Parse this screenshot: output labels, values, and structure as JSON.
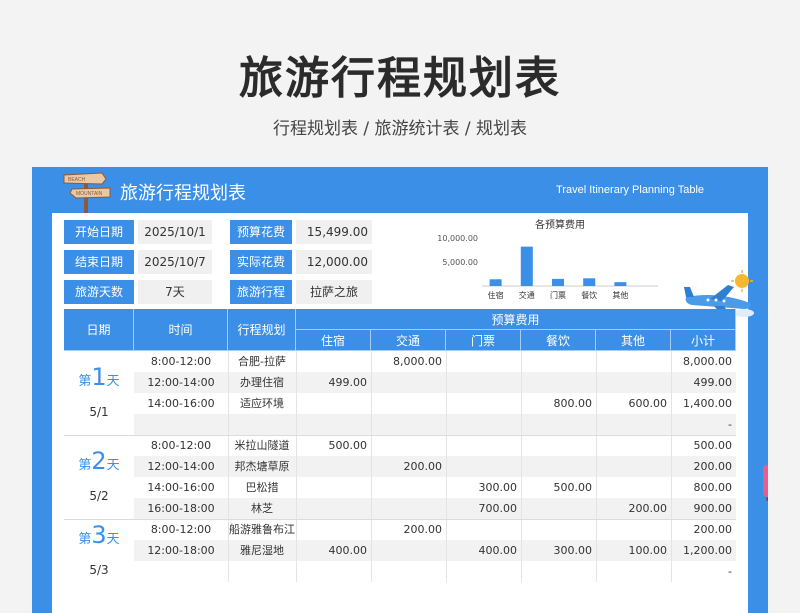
{
  "page": {
    "title": "旅游行程规划表",
    "subtitle": "行程规划表 / 旅游统计表 / 规划表"
  },
  "banner": {
    "title": "旅游行程规划表",
    "subtitle_en": "Travel Itinerary Planning Table",
    "sign_top": "BEACH",
    "sign_bottom": "MOUNTAIN"
  },
  "info": {
    "start_label": "开始日期",
    "start_value": "2025/10/1",
    "end_label": "结束日期",
    "end_value": "2025/10/7",
    "days_label": "旅游天数",
    "days_value": "7天",
    "budget_label": "预算花费",
    "budget_value": "15,499.00",
    "actual_label": "实际花费",
    "actual_value": "12,000.00",
    "trip_label": "旅游行程",
    "trip_value": "拉萨之旅"
  },
  "chart_data": {
    "type": "bar",
    "title": "各预算费用",
    "categories": [
      "住宿",
      "交通",
      "门票",
      "餐饮",
      "其他"
    ],
    "values": [
      1400,
      8200,
      1480,
      1600,
      800
    ],
    "ylim": [
      0,
      10000
    ],
    "yticks": [
      5000,
      10000
    ],
    "ytick_labels": [
      "5,000.00",
      "10,000.00"
    ],
    "color": "#3b8fe6",
    "grid": false
  },
  "table": {
    "headers": {
      "date": "日期",
      "time": "时间",
      "plan": "行程规划",
      "budget": "预算费用",
      "cols": [
        "住宿",
        "交通",
        "门票",
        "餐饮",
        "其他",
        "小计"
      ]
    },
    "days": [
      {
        "num": "1",
        "unit": "天",
        "prefix": "第",
        "date": "5/1",
        "rows": [
          {
            "time": "8:00-12:00",
            "plan": "合肥-拉萨",
            "vals": [
              "",
              "8,000.00",
              "",
              "",
              "",
              "8,000.00"
            ]
          },
          {
            "time": "12:00-14:00",
            "plan": "办理住宿",
            "vals": [
              "499.00",
              "",
              "",
              "",
              "",
              "499.00"
            ]
          },
          {
            "time": "14:00-16:00",
            "plan": "适应环境",
            "vals": [
              "",
              "",
              "",
              "800.00",
              "600.00",
              "1,400.00"
            ]
          },
          {
            "time": "",
            "plan": "",
            "vals": [
              "",
              "",
              "",
              "",
              "",
              "-"
            ]
          }
        ]
      },
      {
        "num": "2",
        "unit": "天",
        "prefix": "第",
        "date": "5/2",
        "rows": [
          {
            "time": "8:00-12:00",
            "plan": "米拉山隧道",
            "vals": [
              "500.00",
              "",
              "",
              "",
              "",
              "500.00"
            ]
          },
          {
            "time": "12:00-14:00",
            "plan": "邦杰塘草原",
            "vals": [
              "",
              "200.00",
              "",
              "",
              "",
              "200.00"
            ]
          },
          {
            "time": "14:00-16:00",
            "plan": "巴松措",
            "vals": [
              "",
              "",
              "300.00",
              "500.00",
              "",
              "800.00"
            ]
          },
          {
            "time": "16:00-18:00",
            "plan": "林芝",
            "vals": [
              "",
              "",
              "700.00",
              "",
              "200.00",
              "900.00"
            ]
          }
        ]
      },
      {
        "num": "3",
        "unit": "天",
        "prefix": "第",
        "date": "5/3",
        "rows": [
          {
            "time": "8:00-12:00",
            "plan": "船游雅鲁布江",
            "vals": [
              "",
              "200.00",
              "",
              "",
              "",
              "200.00"
            ]
          },
          {
            "time": "12:00-18:00",
            "plan": "雅尼湿地",
            "vals": [
              "400.00",
              "",
              "400.00",
              "300.00",
              "100.00",
              "1,200.00"
            ]
          },
          {
            "time": "",
            "plan": "",
            "vals": [
              "",
              "",
              "",
              "",
              "",
              "-"
            ]
          }
        ]
      }
    ]
  }
}
